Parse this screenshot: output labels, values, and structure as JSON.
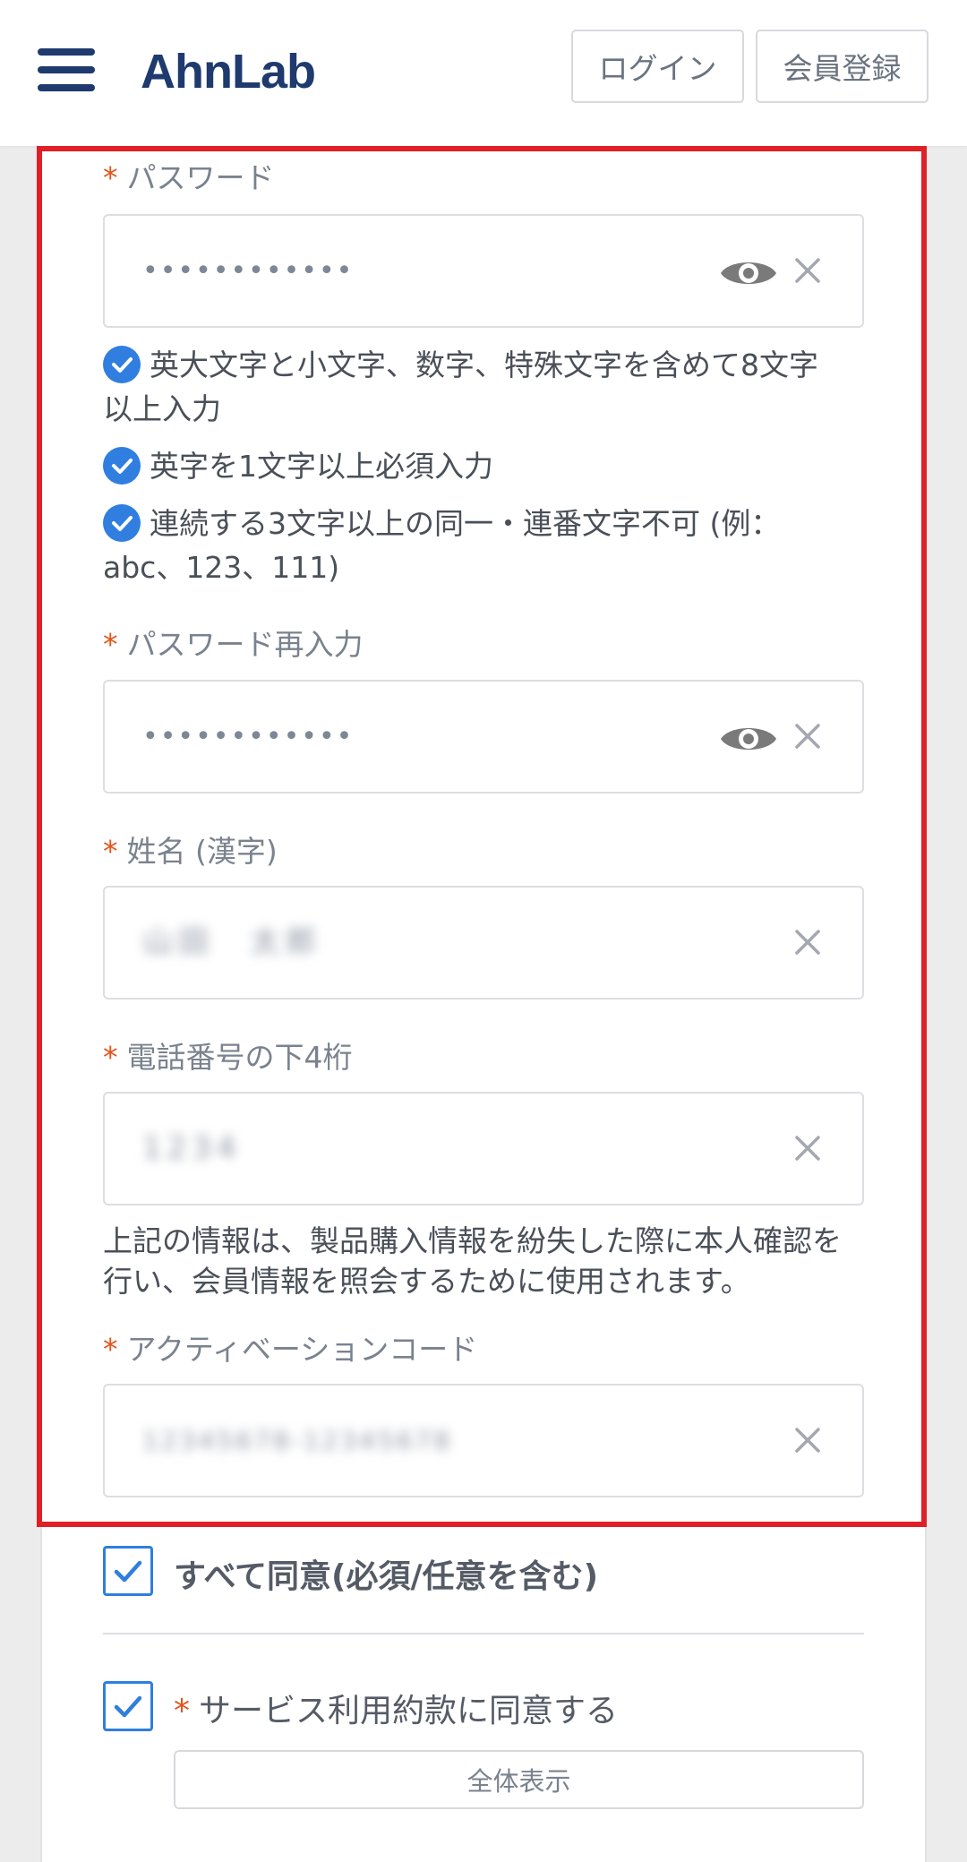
{
  "header": {
    "logo": "AhnLab",
    "login_label": "ログイン",
    "register_label": "会員登録"
  },
  "required_mark": "*",
  "form": {
    "password": {
      "label": "パスワード",
      "value": "••••••••••••"
    },
    "rules": [
      {
        "text": "英大文字と小文字、数字、特殊文字を含めて8文字以上入力"
      },
      {
        "text": "英字を1文字以上必須入力"
      },
      {
        "text": "連続する3文字以上の同一・連番文字不可 (例：abc、123、111)"
      }
    ],
    "password_confirm": {
      "label": "パスワード再入力",
      "value": "••••••••••••"
    },
    "name": {
      "label": "姓名 (漢字)",
      "value": "山田　太郎"
    },
    "phone": {
      "label": "電話番号の下4桁",
      "value": "1234"
    },
    "note": "上記の情報は、製品購入情報を紛失した際に本人確認を行い、会員情報を照会するために使用されます。",
    "activation": {
      "label": "アクティベーションコード",
      "value": "12345678-12345678"
    }
  },
  "agreements": {
    "all_label": "すべて同意(必須/任意を含む)",
    "all_checked": true,
    "tos_label": "サービス利用約款に同意する",
    "tos_checked": true,
    "show_all_label": "全体表示"
  },
  "colors": {
    "brand": "#1e3a6e",
    "check_blue": "#2f7ee0",
    "required_orange": "#e2541b",
    "highlight_red": "#e01f26"
  }
}
